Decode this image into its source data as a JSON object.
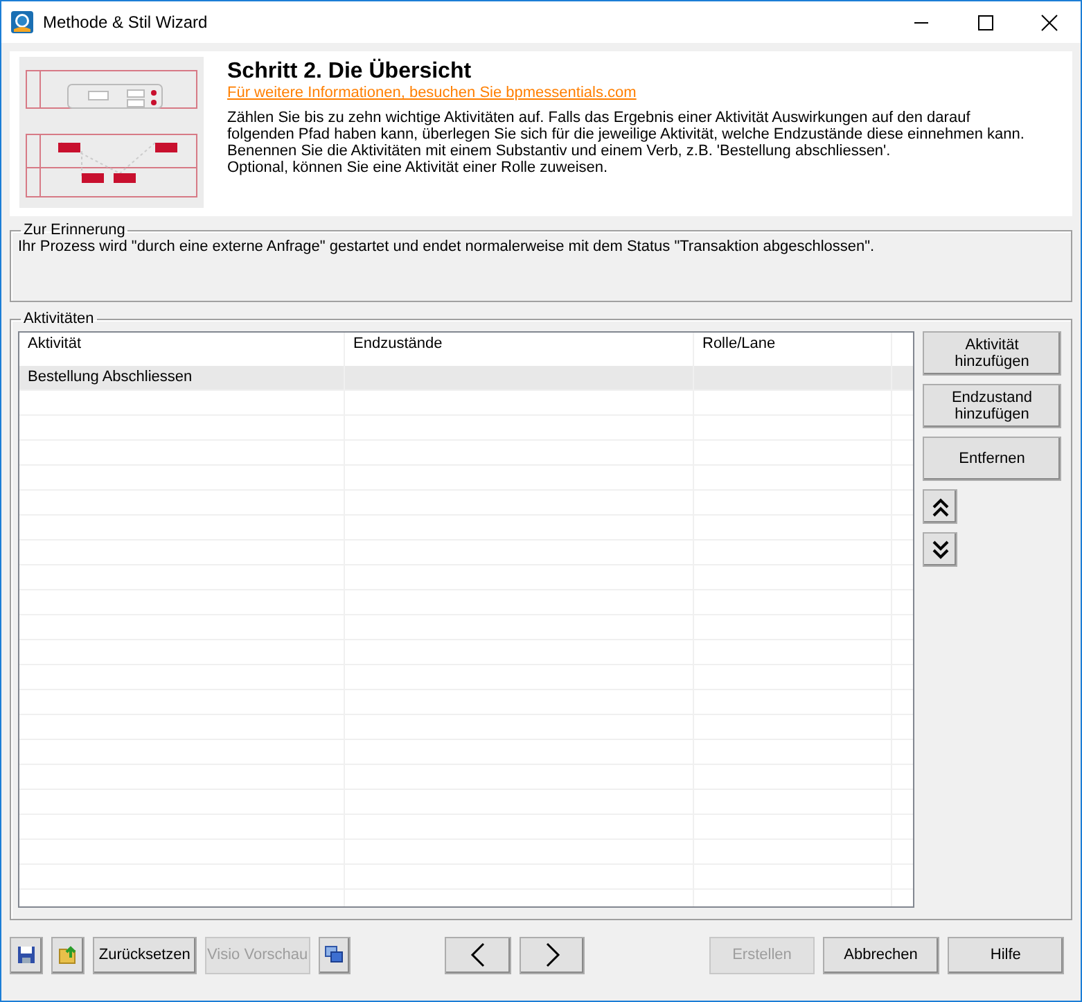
{
  "window": {
    "title": "Methode & Stil Wizard"
  },
  "header": {
    "title": "Schritt 2. Die Übersicht",
    "link": "Für weitere Informationen, besuchen Sie bpmessentials.com",
    "description": [
      "Zählen Sie bis zu zehn wichtige Aktivitäten auf. Falls das Ergebnis einer Aktivität Auswirkungen auf den darauf",
      "folgenden Pfad haben kann, überlegen Sie sich für die jeweilige Aktivität, welche Endzustände diese einnehmen kann.",
      "Benennen Sie die Aktivitäten mit einem Substantiv und einem Verb, z.B. 'Bestellung abschliessen'.",
      "Optional, können Sie eine Aktivität einer Rolle zuweisen."
    ]
  },
  "reminder": {
    "legend": "Zur Erinnerung",
    "text": "Ihr Prozess wird \"durch eine externe Anfrage\" gestartet und endet normalerweise mit dem Status \"Transaktion abgeschlossen\"."
  },
  "activities": {
    "legend": "Aktivitäten",
    "columns": [
      "Aktivität",
      "Endzustände",
      "Rolle/Lane"
    ],
    "rows": [
      {
        "cells": [
          "Bestellung Abschliessen",
          "",
          ""
        ],
        "selected": true
      }
    ],
    "side_buttons": [
      {
        "kind": "text",
        "label": "Aktivität hinzufügen"
      },
      {
        "kind": "text",
        "label": "Endzustand hinzufügen"
      },
      {
        "kind": "text",
        "label": "Entfernen"
      },
      {
        "kind": "up"
      },
      {
        "kind": "down"
      }
    ]
  },
  "footer": {
    "buttons": [
      {
        "kind": "save",
        "disabled": false
      },
      {
        "kind": "export",
        "disabled": false
      },
      {
        "kind": "text",
        "label": "Zurücksetzen",
        "disabled": false
      },
      {
        "kind": "text",
        "label": "Visio Vorschau",
        "disabled": true
      },
      {
        "kind": "copy",
        "disabled": false
      },
      {
        "kind": "back",
        "disabled": false
      },
      {
        "kind": "next",
        "disabled": false
      },
      {
        "kind": "text",
        "label": "Erstellen",
        "disabled": true
      },
      {
        "kind": "text",
        "label": "Abbrechen",
        "disabled": false
      },
      {
        "kind": "text",
        "label": "Hilfe",
        "disabled": false
      }
    ]
  }
}
